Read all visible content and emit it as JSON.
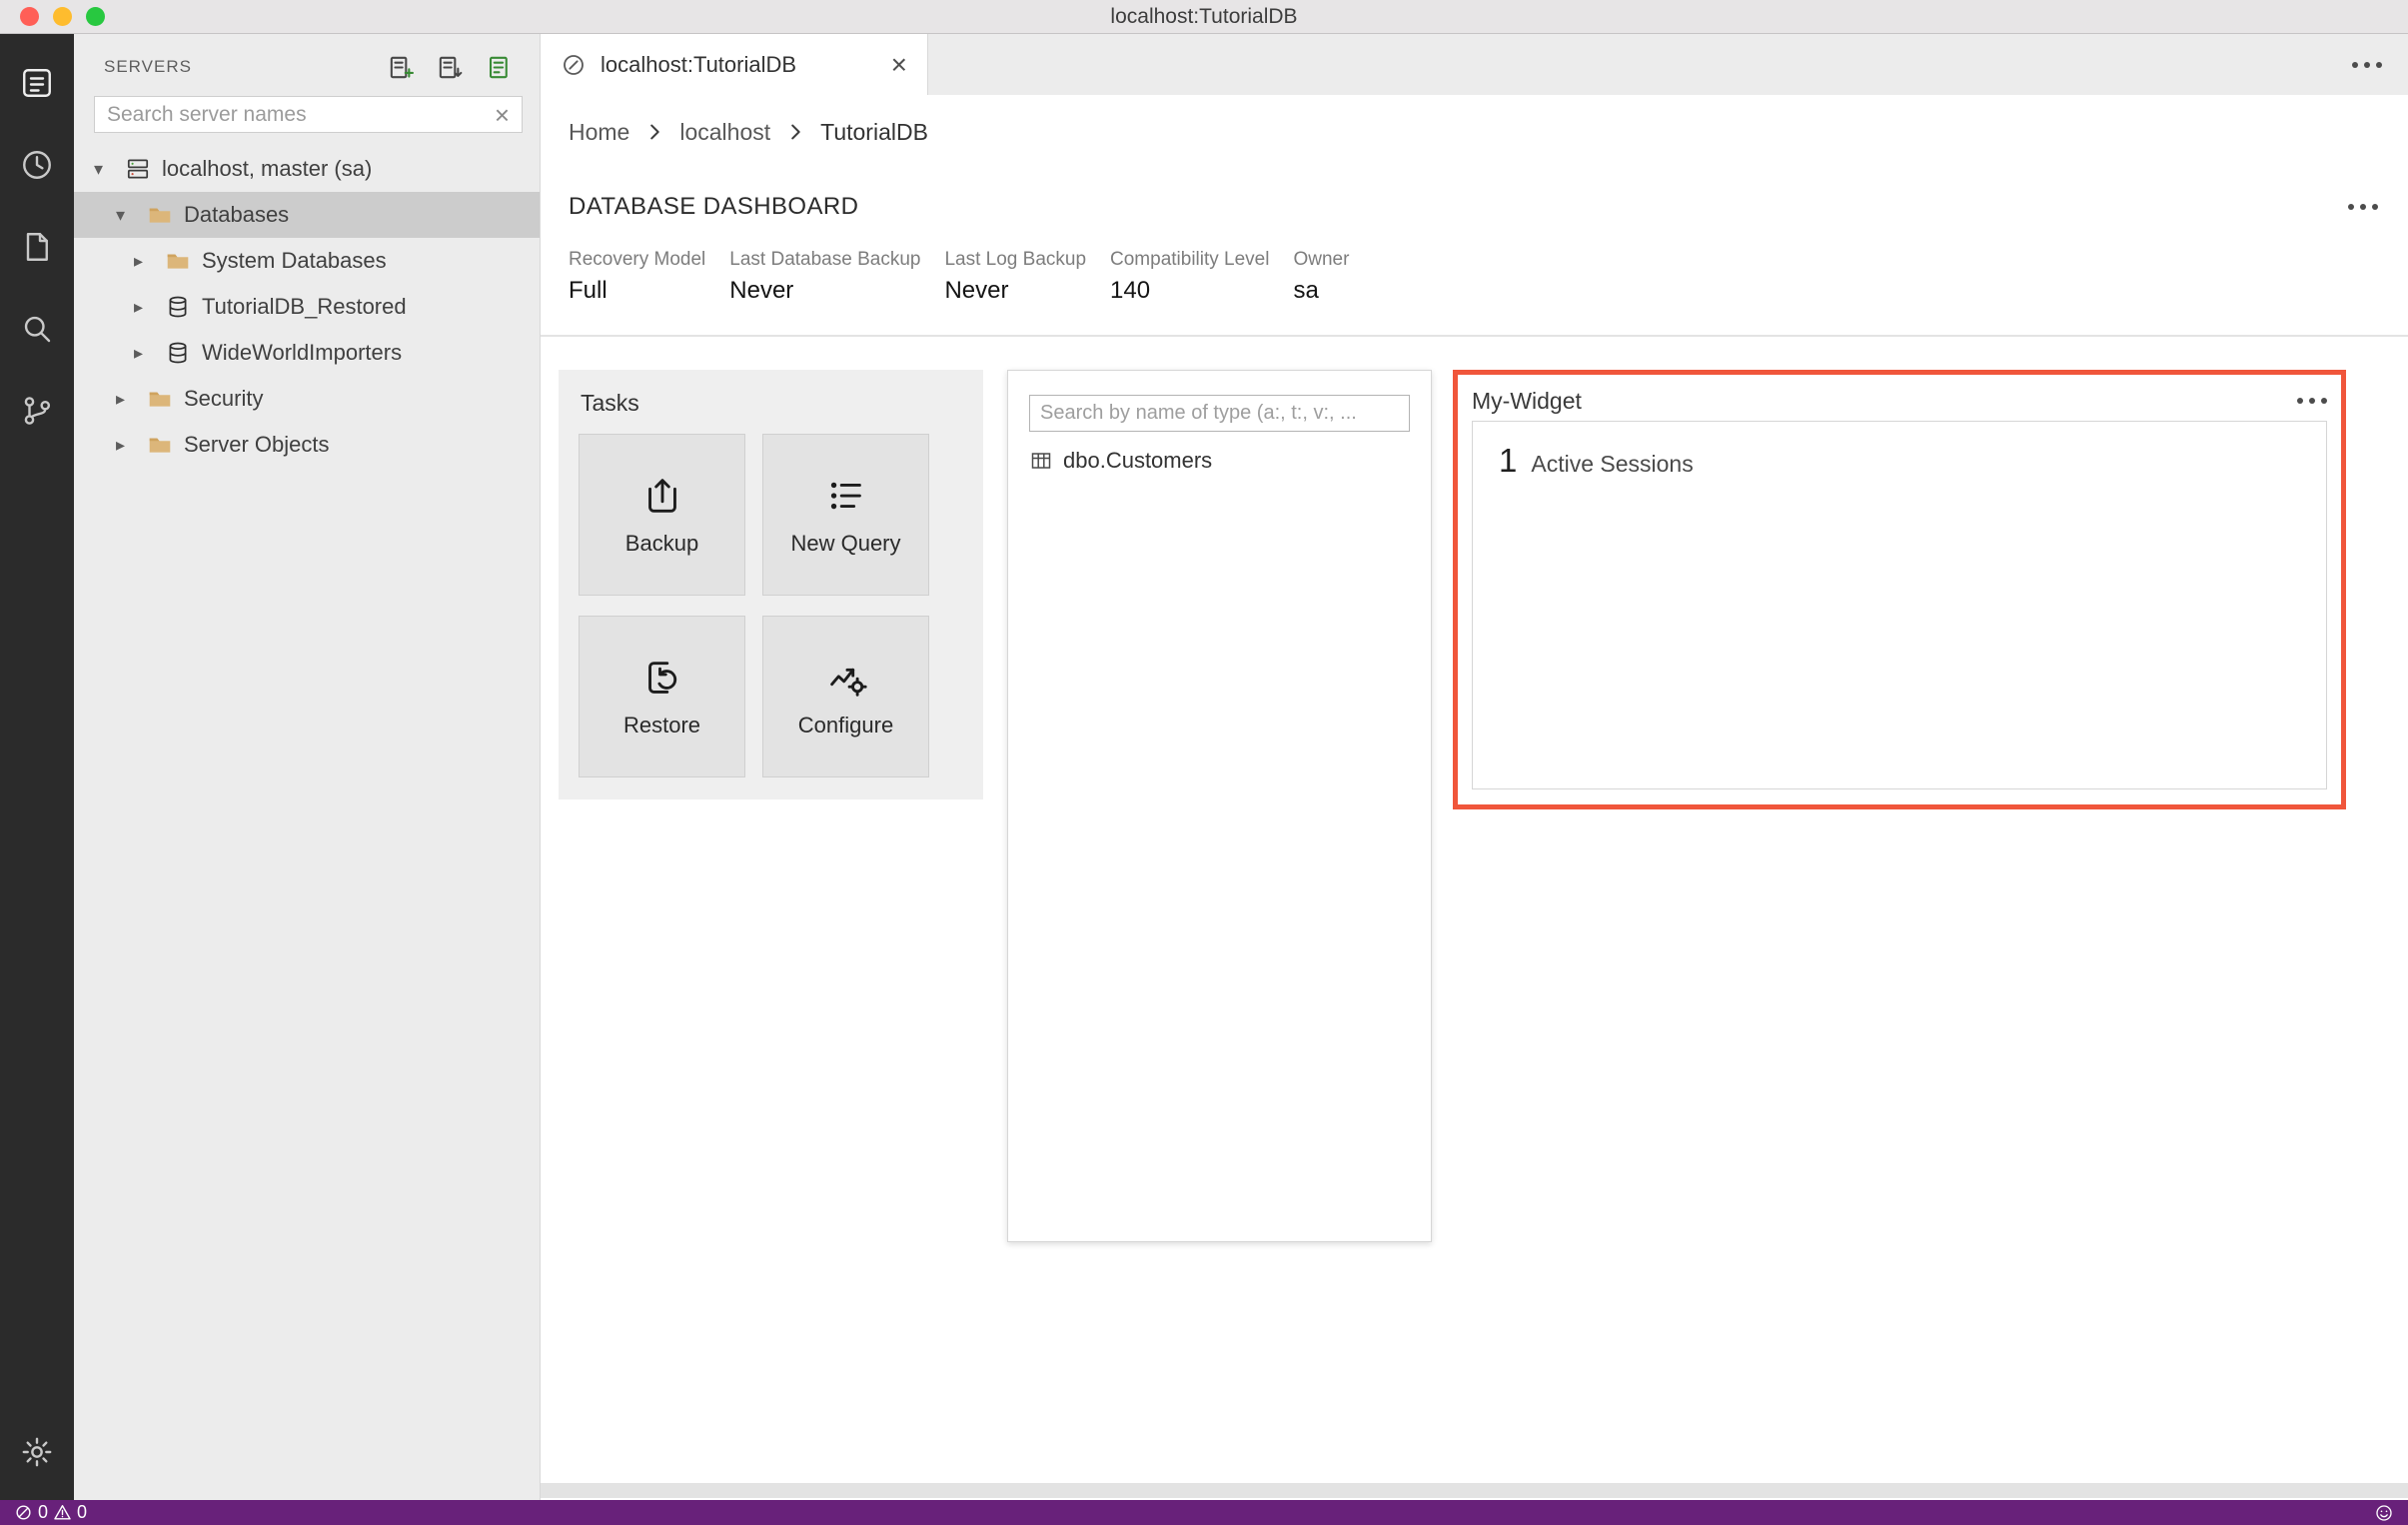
{
  "window": {
    "title": "localhost:TutorialDB"
  },
  "colors": {
    "status_bar": "#68217A",
    "highlight_border": "#F0563B",
    "folder_icon": "#DCB67A",
    "traffic_red": "#FF5F57",
    "traffic_yellow": "#FEBC2E",
    "traffic_green": "#28C840"
  },
  "activity_bar": {
    "icons": [
      "connections",
      "task-history",
      "explorer",
      "search",
      "source-control",
      "settings"
    ]
  },
  "sidebar": {
    "header": "SERVERS",
    "toolbar_icons": [
      "new-connection",
      "new-server-group",
      "active-connections"
    ],
    "search_placeholder": "Search server names",
    "tree": [
      {
        "label": "localhost, master (sa)",
        "level": 0,
        "expanded": true,
        "icon": "server"
      },
      {
        "label": "Databases",
        "level": 1,
        "expanded": true,
        "icon": "folder",
        "selected": true
      },
      {
        "label": "System Databases",
        "level": 2,
        "expanded": false,
        "icon": "folder"
      },
      {
        "label": "TutorialDB_Restored",
        "level": 2,
        "expanded": false,
        "icon": "database"
      },
      {
        "label": "WideWorldImporters",
        "level": 2,
        "expanded": false,
        "icon": "database"
      },
      {
        "label": "Security",
        "level": 1,
        "expanded": false,
        "icon": "folder"
      },
      {
        "label": "Server Objects",
        "level": 1,
        "expanded": false,
        "icon": "folder"
      }
    ]
  },
  "editor": {
    "tab": {
      "title": "localhost:TutorialDB"
    },
    "breadcrumb": [
      "Home",
      "localhost",
      "TutorialDB"
    ]
  },
  "dashboard": {
    "title": "DATABASE DASHBOARD",
    "properties": [
      {
        "label": "Recovery Model",
        "value": "Full"
      },
      {
        "label": "Last Database Backup",
        "value": "Never"
      },
      {
        "label": "Last Log Backup",
        "value": "Never"
      },
      {
        "label": "Compatibility Level",
        "value": "140"
      },
      {
        "label": "Owner",
        "value": "sa"
      }
    ],
    "tasks": {
      "title": "Tasks",
      "buttons": [
        "Backup",
        "New Query",
        "Restore",
        "Configure"
      ]
    },
    "explorer": {
      "search_placeholder": "Search by name of type (a:, t:, v:, ...",
      "items": [
        {
          "label": "dbo.Customers"
        }
      ]
    },
    "my_widget": {
      "title": "My-Widget",
      "value": "1",
      "value_label": "Active Sessions"
    }
  },
  "status_bar": {
    "errors": "0",
    "warnings": "0"
  }
}
